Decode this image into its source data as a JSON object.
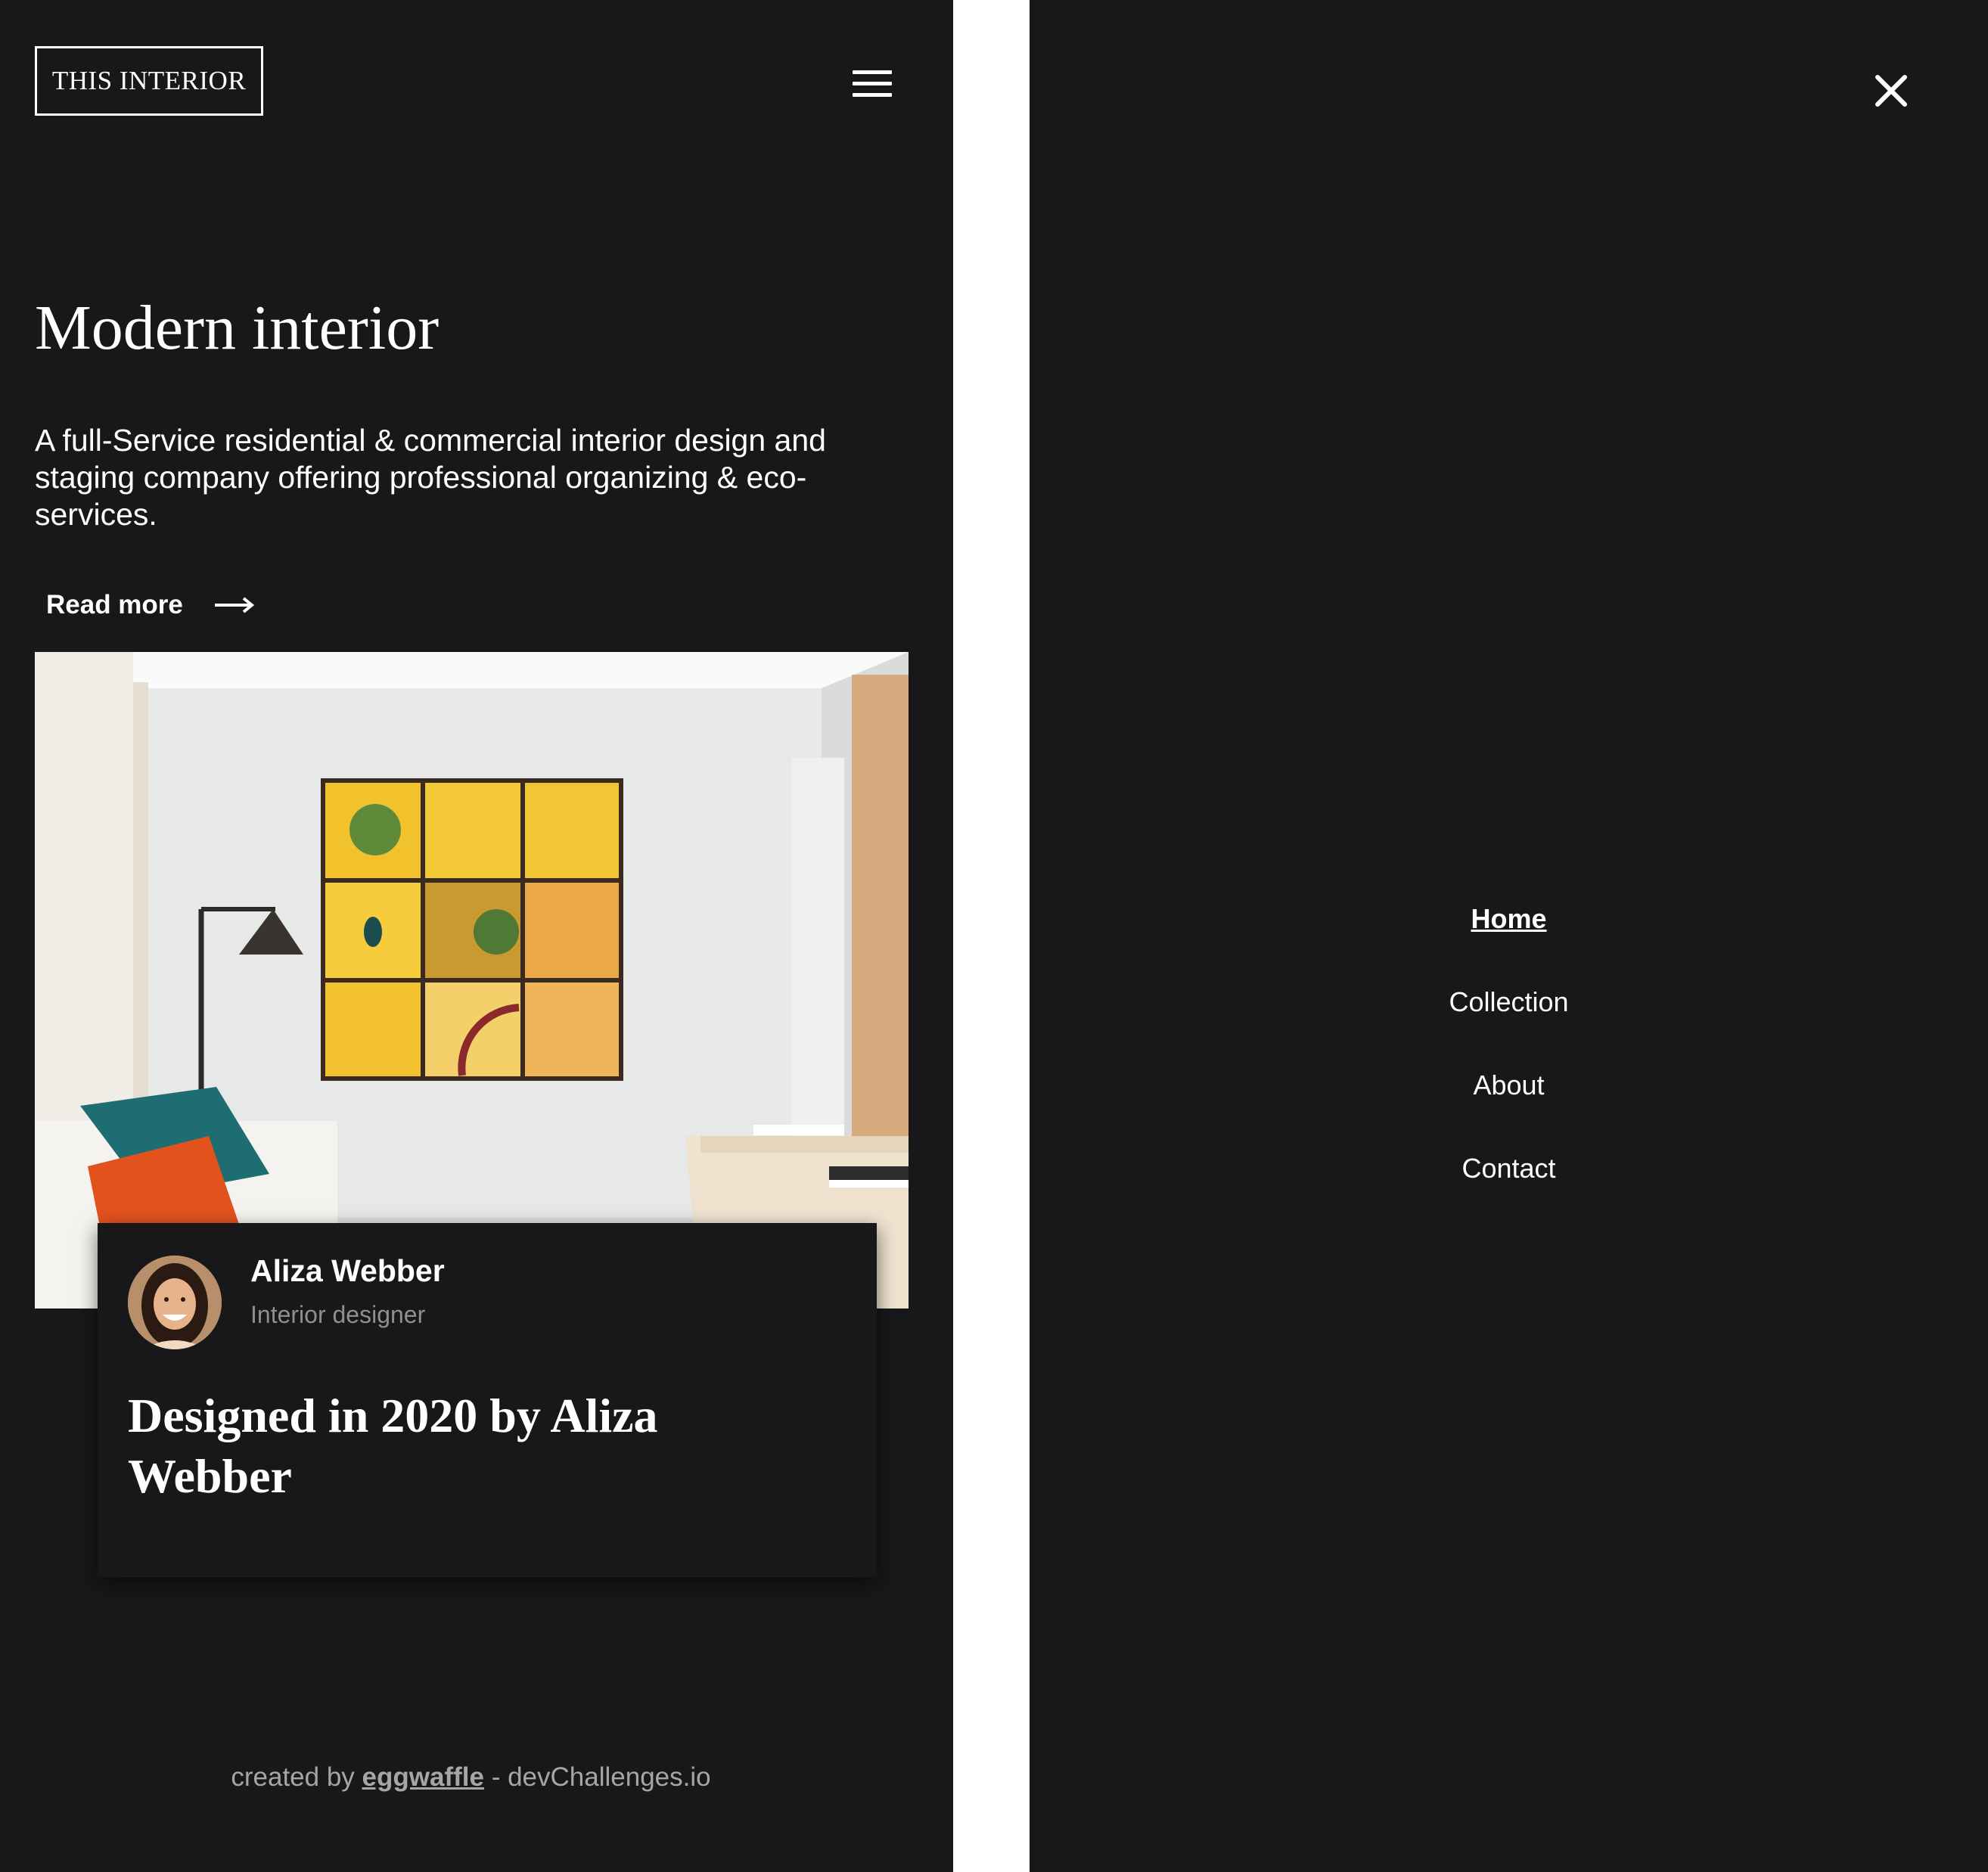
{
  "brand": {
    "logo": "THIS INTERIOR"
  },
  "hero": {
    "title": "Modern interior",
    "description": "A full-Service residential & commercial interior design and staging company offering professional organizing & eco-services.",
    "read_more": "Read more"
  },
  "card": {
    "author_name": "Aliza Webber",
    "author_role": "Interior designer",
    "title": "Designed in 2020 by Aliza Webber"
  },
  "footer": {
    "prefix": "created by",
    "author_link": "eggwaffle",
    "suffix": "- devChallenges.io"
  },
  "menu": {
    "items": [
      {
        "label": "Home",
        "active": true
      },
      {
        "label": "Collection",
        "active": false
      },
      {
        "label": "About",
        "active": false
      },
      {
        "label": "Contact",
        "active": false
      }
    ]
  },
  "icons": {
    "menu": "hamburger-icon",
    "close": "close-icon",
    "arrow": "arrow-right-icon"
  },
  "colors": {
    "background": "#18181b",
    "text": "#ffffff",
    "muted": "#8f8f8f",
    "divider": "#ffffff"
  }
}
